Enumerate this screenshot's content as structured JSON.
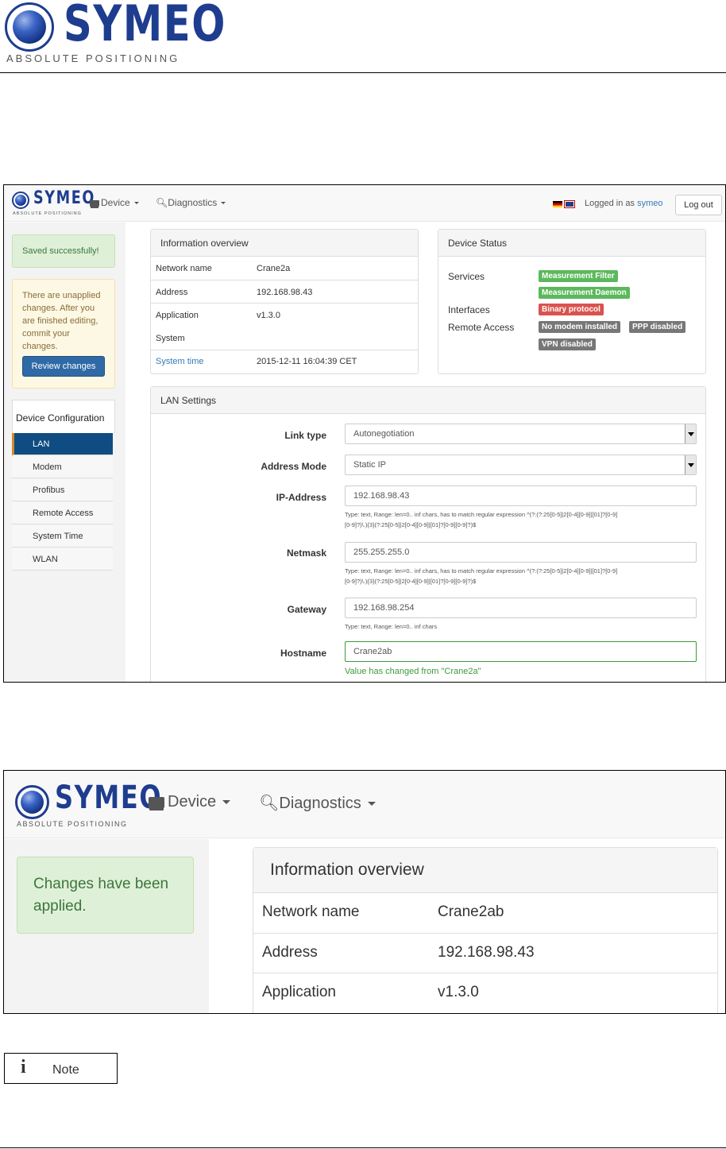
{
  "logo": {
    "word": "SYMEO",
    "tagline": "ABSOLUTE POSITIONING"
  },
  "navbar": {
    "device_label": "Device",
    "diagnostics_label": "Diagnostics",
    "logged_in_text": "Logged in as",
    "username": "symeo",
    "logout_label": "Log out"
  },
  "sidebar": {
    "saved_message": "Saved successfully!",
    "unapplied_message": "There are unapplied changes. After you are finished editing, commit your changes.",
    "review_button": "Review changes",
    "config_title": "Device Configuration",
    "items": [
      {
        "label": "LAN",
        "active": true
      },
      {
        "label": "Modem"
      },
      {
        "label": "Profibus"
      },
      {
        "label": "Remote Access"
      },
      {
        "label": "System Time"
      },
      {
        "label": "WLAN"
      }
    ]
  },
  "info_overview": {
    "title": "Information overview",
    "rows": [
      {
        "label": "Network name",
        "value": "Crane2a"
      },
      {
        "label": "Address",
        "value": "192.168.98.43"
      },
      {
        "label": "Application",
        "value": "v1.3.0"
      },
      {
        "label": "System",
        "value": ""
      },
      {
        "label": "System time",
        "value": "2015-12-11 16:04:39 CET"
      }
    ]
  },
  "device_status": {
    "title": "Device Status",
    "services_label": "Services",
    "interfaces_label": "Interfaces",
    "remote_access_label": "Remote Access",
    "badges": {
      "measurement_filter": "Measurement Filter",
      "measurement_daemon": "Measurement Daemon",
      "binary_protocol": "Binary protocol",
      "no_modem": "No modem installed",
      "ppp_disabled": "PPP disabled",
      "vpn_disabled": "VPN disabled"
    },
    "colors": {
      "ok": "#5cb85c",
      "error": "#d9534f",
      "inactive": "#777777"
    }
  },
  "lan_settings": {
    "title": "LAN Settings",
    "link_type": {
      "label": "Link type",
      "value": "Autonegotiation"
    },
    "address_mode": {
      "label": "Address Mode",
      "value": "Static IP"
    },
    "ip_address": {
      "label": "IP-Address",
      "value": "192.168.98.43",
      "help_line1": "Type: text, Range: len=0.. inf chars, has to match regular expression ^(?:(?:25[0-5]|2[0-4][0-9]|[01]?[0-9]",
      "help_line2": "[0-9]?)\\.){3}(?:25[0-5]|2[0-4][0-9]|[01]?[0-9][0-9]?)$"
    },
    "netmask": {
      "label": "Netmask",
      "value": "255.255.255.0",
      "help_line1": "Type: text, Range: len=0.. inf chars, has to match regular expression ^(?:(?:25[0-5]|2[0-4][0-9]|[01]?[0-9]",
      "help_line2": "[0-9]?)\\.){3}(?:25[0-5]|2[0-4][0-9]|[01]?[0-9][0-9]?)$"
    },
    "gateway": {
      "label": "Gateway",
      "value": "192.168.98.254",
      "help": "Type: text, Range: len=0.. inf chars"
    },
    "hostname": {
      "label": "Hostname",
      "value": "Crane2ab",
      "changed_msg": "Value has changed from \"Crane2a\""
    }
  },
  "applied_view": {
    "device_label": "Device",
    "diagnostics_label": "Diagnostics",
    "applied_message": "Changes have been applied.",
    "info_title": "Information overview",
    "rows": [
      {
        "label": "Network name",
        "value": "Crane2ab"
      },
      {
        "label": "Address",
        "value": "192.168.98.43"
      },
      {
        "label": "Application",
        "value": "v1.3.0"
      }
    ]
  },
  "note": {
    "label": "Note"
  }
}
